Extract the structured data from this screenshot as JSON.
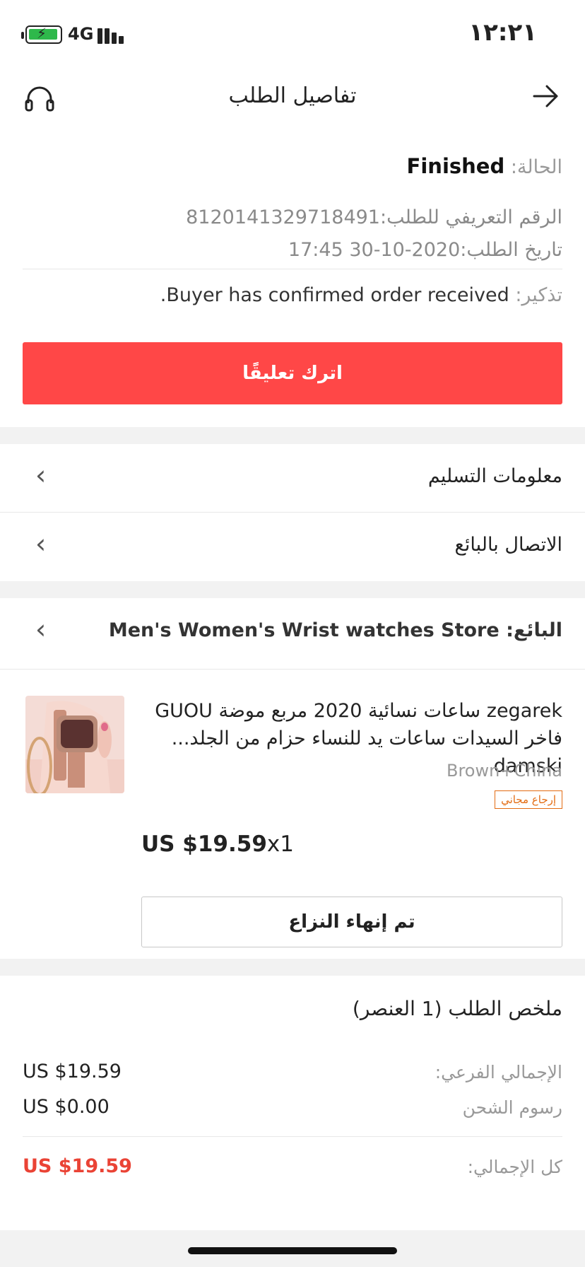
{
  "status_bar": {
    "network": "4G",
    "time": "١٢:٢١"
  },
  "header": {
    "title": "تفاصيل الطلب",
    "back_icon": "arrow-right-icon",
    "support_icon": "headset-icon"
  },
  "order": {
    "status_label": "الحالة:",
    "status_value": "Finished",
    "id_line": "الرقم التعريفي للطلب:8120141329718491",
    "date_line": "تاريخ الطلب:2020-10-30 17:45",
    "reminder_label": "تذكير:",
    "reminder_text": "Buyer has confirmed order received.",
    "feedback_button": "اترك تعليقًا"
  },
  "nav": {
    "delivery_info": "معلومات التسليم",
    "contact_seller": "الاتصال بالبائع"
  },
  "seller": {
    "label": "البائع:",
    "name": "Men's Women's Wrist watches Store"
  },
  "product": {
    "title_line1": "zegarek ساعات نسائية 2020 مربع موضة GUOU",
    "title_line2": "فاخر السيدات ساعات يد للنساء حزام من الجلد... damski",
    "sku": "Brown+China",
    "free_return_badge": "إرجاع مجاني",
    "price": "US $19.59",
    "quantity": "x1",
    "dispute_button": "تم إنهاء النزاع"
  },
  "summary": {
    "title": "ملخص الطلب (1 العنصر)",
    "subtotal_label": "الإجمالي الفرعي:",
    "subtotal_value": "US $19.59",
    "shipping_label": "رسوم الشحن",
    "shipping_value": "US $0.00",
    "total_label": "كل الإجمالي:",
    "total_value": "US $19.59"
  },
  "colors": {
    "accent_red": "#ff4747",
    "total_red": "#ea4335",
    "badge_orange": "#e36b12",
    "battery_green": "#2eb84b"
  }
}
